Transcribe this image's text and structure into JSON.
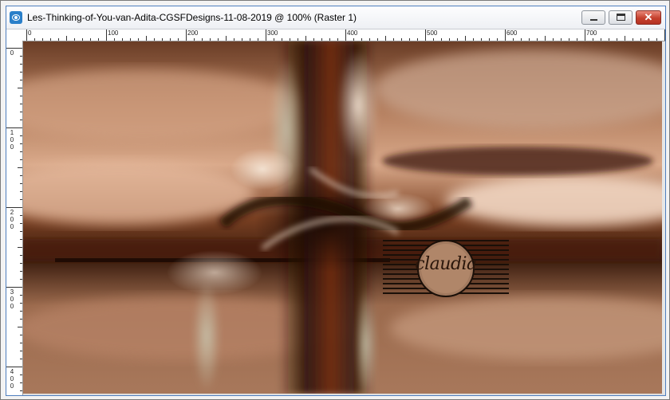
{
  "window": {
    "title": "Les-Thinking-of-You-van-Adita-CGSFDesigns-11-08-2019 @ 100% (Raster 1)",
    "app_icon": "paintshop-pro-icon",
    "buttons": {
      "minimize": "minimize-icon",
      "maximize": "maximize-icon",
      "close": "close-icon"
    },
    "close_glyph": "✕"
  },
  "ruler_top": {
    "labels": [
      "0",
      "100",
      "200",
      "300",
      "400",
      "500",
      "600",
      "700"
    ]
  },
  "ruler_left": {
    "labels": [
      "0",
      "1\n0\n0",
      "2\n0\n0",
      "3\n0\n0",
      "4\n0\n0"
    ]
  },
  "canvas": {
    "description_colors": {
      "dark": "#3a1a0c",
      "rust": "#8a3d14",
      "copper": "#b8764d",
      "cream": "#f0ddcc",
      "sage": "#8f8a72"
    }
  },
  "watermark": {
    "text": "claudia"
  }
}
